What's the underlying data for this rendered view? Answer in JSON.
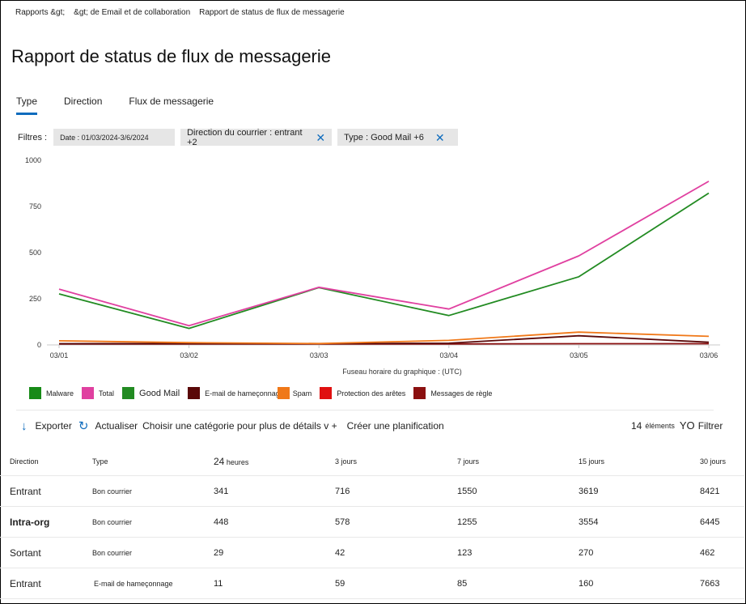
{
  "breadcrumb": [
    "Rapports &gt;",
    "&gt; de Email et de collaboration",
    "Rapport de status de flux de messagerie"
  ],
  "title": "Rapport de status de flux de messagerie",
  "tabs": [
    {
      "label": "Type",
      "active": true
    },
    {
      "label": "Direction",
      "active": false
    },
    {
      "label": "Flux de messagerie",
      "active": false
    }
  ],
  "filters": {
    "label": "Filtres :",
    "chips": [
      "Date : 01/03/2024-3/6/2024",
      "Direction du courrier : entrant +2",
      "Type : Good Mail +6"
    ]
  },
  "chart_data": {
    "type": "line",
    "x": [
      "03/01",
      "03/02",
      "03/03",
      "03/04",
      "03/05",
      "03/06"
    ],
    "ylim": [
      0,
      1000
    ],
    "yticks": [
      0,
      250,
      500,
      750,
      1000
    ],
    "xlabel": "Fuseau horaire du graphique : (UTC)",
    "grid": false,
    "series": [
      {
        "name": "Total",
        "color": "#e040a0",
        "values": [
          298,
          100,
          308,
          190,
          478,
          882
        ]
      },
      {
        "name": "Good Mail",
        "color": "#228b22",
        "values": [
          272,
          85,
          306,
          155,
          365,
          818
        ]
      },
      {
        "name": "Spam",
        "color": "#f07818",
        "values": [
          18,
          8,
          3,
          20,
          65,
          42
        ]
      },
      {
        "name": "E-mail de hameçonnage",
        "color": "#5a0808",
        "values": [
          2,
          3,
          2,
          5,
          45,
          10
        ]
      },
      {
        "name": "Messages de règle",
        "color": "#8b1010",
        "values": [
          1,
          1,
          1,
          1,
          2,
          2
        ]
      }
    ]
  },
  "legend": [
    {
      "label": "Malware",
      "color": "#178a17"
    },
    {
      "label": "Total",
      "color": "#e040a0"
    },
    {
      "label": "Good Mail",
      "color": "#228b22"
    },
    {
      "label": "E-mail de hameçonnage",
      "color": "#5a0808"
    },
    {
      "label": "Spam",
      "color": "#f07818"
    },
    {
      "label": "Protection des arêtes",
      "color": "#e01010"
    },
    {
      "label": "Messages de règle",
      "color": "#8b1010"
    }
  ],
  "toolbar": {
    "export": "Exporter",
    "refresh": "Actualiser",
    "category": "Choisir une catégorie pour plus de détails v +",
    "schedule": "Créer une planification"
  },
  "count": {
    "value": "14",
    "unit": "éléments",
    "yo": "YO",
    "filter": "Filtrer"
  },
  "table": {
    "headers": {
      "direction": "Direction",
      "type": "Type",
      "h24_num": "24",
      "h24_unit": "heures",
      "d3": "3 jours",
      "d7": "7 jours",
      "d15": "15 jours",
      "d30": "30 jours"
    },
    "rows": [
      {
        "direction": "Entrant",
        "type": "Bon courrier",
        "v": [
          "341",
          "716",
          "1550",
          "3619",
          "8421"
        ]
      },
      {
        "direction": "Intra-org",
        "type": "Bon courrier",
        "v": [
          "448",
          "578",
          "1255",
          "3554",
          "6445"
        ]
      },
      {
        "direction": "Sortant",
        "type": "Bon courrier",
        "v": [
          "29",
          "42",
          "123",
          "270",
          "462"
        ]
      },
      {
        "direction": "Entrant",
        "type": "E-mail de hameçonnage",
        "v": [
          "11",
          "59",
          "85",
          "160",
          "7663"
        ]
      }
    ]
  }
}
